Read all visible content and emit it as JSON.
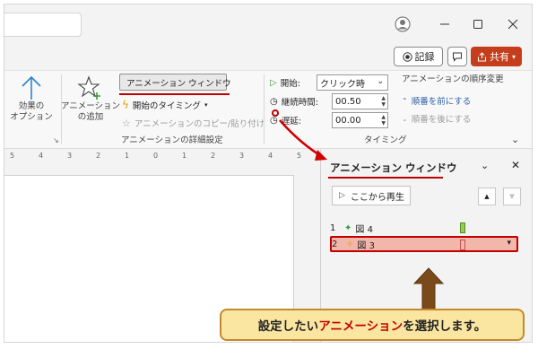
{
  "topbar": {
    "avatar_icon": "user-circle-icon",
    "minimize_icon": "minimize-icon",
    "maximize_icon": "maximize-icon",
    "close_icon": "close-icon",
    "record_label": "記録",
    "share_label": "共有"
  },
  "ribbon": {
    "effect_options_label_1": "効果の",
    "effect_options_label_2": "オプション",
    "add_animation_label_1": "アニメーション",
    "add_animation_label_2": "の追加",
    "animation_pane_btn": "アニメーション ウィンドウ",
    "trigger_btn": "開始のタイミング",
    "painter_btn": "アニメーションのコピー/貼り付け",
    "advanced_group_label": "アニメーションの詳細設定",
    "start_label": "開始:",
    "start_value": "クリック時",
    "duration_label": "継続時間:",
    "duration_value": "00.50",
    "delay_label": "遅延:",
    "delay_value": "00.00",
    "timing_group_label": "タイミング",
    "reorder_label": "アニメーションの順序変更",
    "move_earlier": "順番を前にする",
    "move_later": "順番を後にする"
  },
  "ruler": {
    "marks": [
      "5",
      "4",
      "3",
      "2",
      "1",
      "0",
      "1",
      "2",
      "3",
      "4",
      "5"
    ]
  },
  "pane": {
    "title": "アニメーション ウィンドウ",
    "play_from": "ここから再生",
    "items": [
      {
        "num": "1",
        "name": "図 4"
      },
      {
        "num": "2",
        "name": "図 3"
      }
    ]
  },
  "callout": {
    "text_before": "設定したい",
    "text_highlight": "アニメーション",
    "text_after": "を選択します。"
  },
  "colors": {
    "accent_red": "#c00000",
    "share_bg": "#c43e1c",
    "callout_bg": "#fbe6a1",
    "selected_row": "#f2b6aa",
    "timebar_green": "#92d050"
  }
}
